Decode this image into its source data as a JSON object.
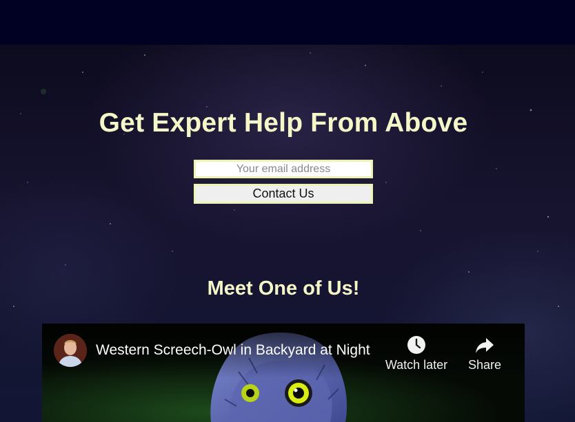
{
  "page": {
    "colors": {
      "topbar": "#010124",
      "heading": "#f5f7c8",
      "field_border": "#eef3b3"
    }
  },
  "hero": {
    "title": "Get Expert Help From Above",
    "email_placeholder": "Your email address",
    "contact_button": "Contact Us"
  },
  "section": {
    "title": "Meet One of Us!"
  },
  "video": {
    "title": "Western Screech-Owl in Backyard at Night",
    "actions": [
      {
        "label": "Watch later",
        "icon": "clock-icon"
      },
      {
        "label": "Share",
        "icon": "share-arrow-icon"
      }
    ]
  }
}
